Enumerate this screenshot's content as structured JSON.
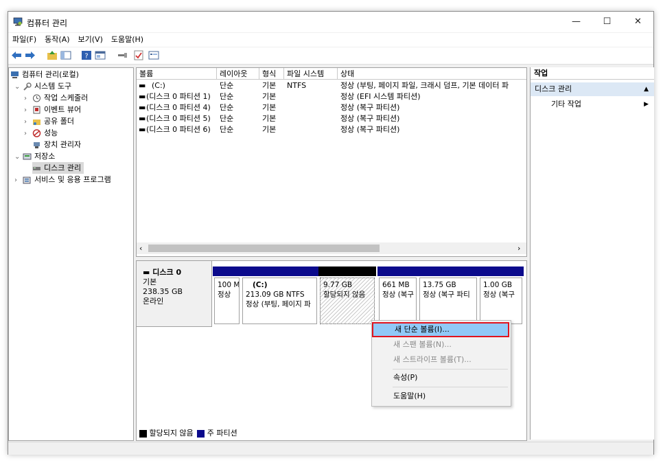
{
  "window": {
    "title": "컴퓨터 관리",
    "minimize": "—",
    "maximize": "☐",
    "close": "✕"
  },
  "menu": [
    "파일(F)",
    "동작(A)",
    "보기(V)",
    "도움말(H)"
  ],
  "toolbar_icons": [
    "back-icon",
    "forward-icon",
    "up-folder-icon",
    "show-hide-tree-icon",
    "help-icon",
    "properties-icon",
    "connect-icon",
    "check-icon",
    "console-icon"
  ],
  "tree": {
    "root": "컴퓨터 관리(로컬)",
    "system_tools": "시스템 도구",
    "task_scheduler": "작업 스케줄러",
    "event_viewer": "이벤트 뷰어",
    "shared_folders": "공유 폴더",
    "performance": "성능",
    "device_manager": "장치 관리자",
    "storage": "저장소",
    "disk_management": "디스크 관리",
    "services_apps": "서비스 및 응용 프로그램"
  },
  "volume_table": {
    "columns": [
      "볼륨",
      "레이아웃",
      "형식",
      "파일 시스템",
      "상태"
    ],
    "rows": [
      {
        "volume": "(C:)",
        "layout": "단순",
        "type": "기본",
        "fs": "NTFS",
        "status": "정상 (부팅, 페이지 파일, 크래시 덤프, 기본 데이터 파"
      },
      {
        "volume": "(디스크 0 파티션 1)",
        "layout": "단순",
        "type": "기본",
        "fs": "",
        "status": "정상 (EFI 시스템 파티션)"
      },
      {
        "volume": "(디스크 0 파티션 4)",
        "layout": "단순",
        "type": "기본",
        "fs": "",
        "status": "정상 (복구 파티션)"
      },
      {
        "volume": "(디스크 0 파티션 5)",
        "layout": "단순",
        "type": "기본",
        "fs": "",
        "status": "정상 (복구 파티션)"
      },
      {
        "volume": "(디스크 0 파티션 6)",
        "layout": "단순",
        "type": "기본",
        "fs": "",
        "status": "정상 (복구 파티션)"
      }
    ],
    "scroll_left": "‹",
    "scroll_right": "›"
  },
  "disk": {
    "name": "디스크 0",
    "type": "기본",
    "size": "238.35 GB",
    "state": "온라인",
    "partitions": [
      {
        "line1": "",
        "line2": "100 M",
        "line3": "정상"
      },
      {
        "line1": "(C:)",
        "line2": "213.09 GB NTFS",
        "line3": "정상 (부팅, 페이지 파"
      },
      {
        "line1": "",
        "line2": "9.77 GB",
        "line3": "할당되지 않음"
      },
      {
        "line1": "",
        "line2": "661 MB",
        "line3": "정상 (복구"
      },
      {
        "line1": "",
        "line2": "13.75 GB",
        "line3": "정상 (복구 파티"
      },
      {
        "line1": "",
        "line2": "1.00 GB",
        "line3": "정상 (복구"
      }
    ]
  },
  "legend": {
    "unallocated": "할당되지 않음",
    "primary": "주 파티션"
  },
  "context_menu": {
    "new_simple": "새 단순 볼륨(I)...",
    "new_spanned": "새 스팬 볼륨(N)...",
    "new_striped": "새 스트라이프 볼륨(T)...",
    "properties": "속성(P)",
    "help": "도움말(H)"
  },
  "actions": {
    "header": "작업",
    "section": "디스크 관리",
    "more": "기타 작업"
  },
  "colors": {
    "primary_partition": "#0b0a8c",
    "selection": "#91c9f7",
    "highlight_border": "#e0141e",
    "action_section": "#dce8f5"
  }
}
